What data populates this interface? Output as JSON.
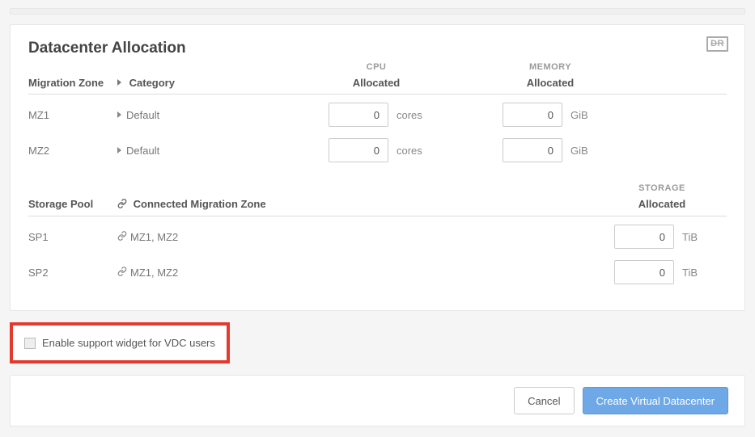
{
  "title": "Datacenter Allocation",
  "badge_text": "DR",
  "headers": {
    "cpu": "CPU",
    "memory": "MEMORY",
    "storage": "STORAGE"
  },
  "cols": {
    "migration_zone": "Migration Zone",
    "category": "Category",
    "allocated": "Allocated",
    "storage_pool": "Storage Pool",
    "connected_mz": "Connected Migration Zone"
  },
  "units": {
    "cores": "cores",
    "gib": "GiB",
    "tib": "TiB"
  },
  "mz_rows": [
    {
      "name": "MZ1",
      "category": "Default",
      "cpu": "0",
      "mem": "0"
    },
    {
      "name": "MZ2",
      "category": "Default",
      "cpu": "0",
      "mem": "0"
    }
  ],
  "sp_rows": [
    {
      "name": "SP1",
      "cmz": "MZ1, MZ2",
      "alloc": "0"
    },
    {
      "name": "SP2",
      "cmz": "MZ1, MZ2",
      "alloc": "0"
    }
  ],
  "checkbox_label": "Enable support widget for VDC users",
  "buttons": {
    "cancel": "Cancel",
    "create": "Create Virtual Datacenter"
  }
}
